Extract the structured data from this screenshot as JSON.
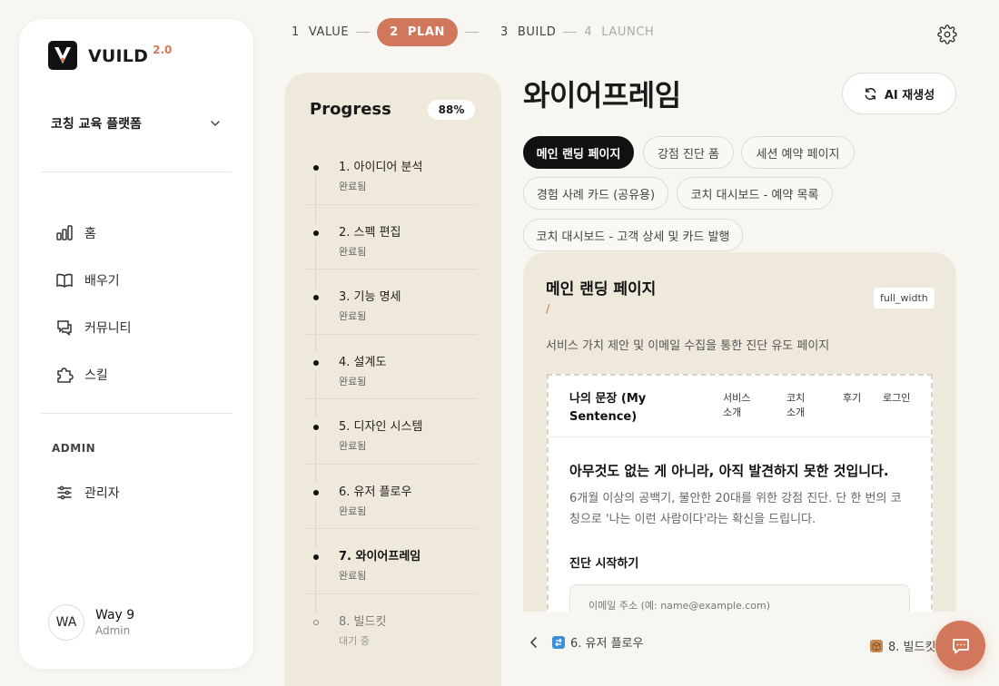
{
  "brand": {
    "name": "VUILD",
    "version": "2.0"
  },
  "project": {
    "selected": "코칭 교육 플랫폼"
  },
  "nav": {
    "items": [
      {
        "label": "홈",
        "icon": "chart-bar-icon"
      },
      {
        "label": "배우기",
        "icon": "book-icon"
      },
      {
        "label": "커뮤니티",
        "icon": "chat-icon"
      },
      {
        "label": "스킬",
        "icon": "puzzle-icon"
      }
    ],
    "admin_section": "ADMIN",
    "admin_label": "관리자"
  },
  "user": {
    "initials": "WA",
    "name": "Way 9",
    "role": "Admin"
  },
  "stepper": {
    "steps": [
      {
        "num": "1",
        "label": "VALUE",
        "state": "done"
      },
      {
        "num": "2",
        "label": "PLAN",
        "state": "active"
      },
      {
        "num": "3",
        "label": "BUILD",
        "state": "done"
      },
      {
        "num": "4",
        "label": "LAUNCH",
        "state": "upcoming"
      }
    ]
  },
  "progress": {
    "title": "Progress",
    "percent": "88%",
    "steps": [
      {
        "label": "1. 아이디어 분석",
        "status": "완료됨"
      },
      {
        "label": "2. 스펙 편집",
        "status": "완료됨"
      },
      {
        "label": "3. 기능 명세",
        "status": "완료됨"
      },
      {
        "label": "4. 설계도",
        "status": "완료됨"
      },
      {
        "label": "5. 디자인 시스템",
        "status": "완료됨"
      },
      {
        "label": "6. 유저 플로우",
        "status": "완료됨"
      },
      {
        "label": "7. 와이어프레임",
        "status": "완료됨"
      },
      {
        "label": "8. 빌드킷",
        "status": "대기 중"
      }
    ]
  },
  "main": {
    "title": "와이어프레임",
    "regen_label": "AI 재생성",
    "chips": [
      "메인 랜딩 페이지",
      "강점 진단 폼",
      "세션 예약 페이지",
      "경험 사례 카드 (공유용)",
      "코치 대시보드 - 예약 목록",
      "코치 대시보드 - 고객 상세 및 카드 발행"
    ]
  },
  "preview": {
    "title": "메인 랜딩 페이지",
    "path": "/",
    "layout_badge": "full_width",
    "description": "서비스 가치 제안 및 이메일 수집을 통한 진단 유도 페이지",
    "wireframe": {
      "logo": "나의 문장 (My Sentence)",
      "nav": [
        "서비스 소개",
        "코치 소개",
        "후기",
        "로그인"
      ],
      "hero": "아무것도 없는 게 아니라, 아직 발견하지 못한 것입니다.",
      "sub": "6개월 이상의 공백기, 불안한 20대를 위한 강점 진단. 단 한 번의 코칭으로 '나는 이런 사람이다'라는 확신을 드립니다.",
      "cta": "진단 시작하기",
      "input_placeholder": "이메일 주소 (예: name@example.com)"
    }
  },
  "footer": {
    "prev": "6. 유저 플로우",
    "next": "8. 빌드킷"
  },
  "colors": {
    "accent": "#d0775c",
    "panel": "#efe9dc",
    "background": "#f8f6f1"
  }
}
